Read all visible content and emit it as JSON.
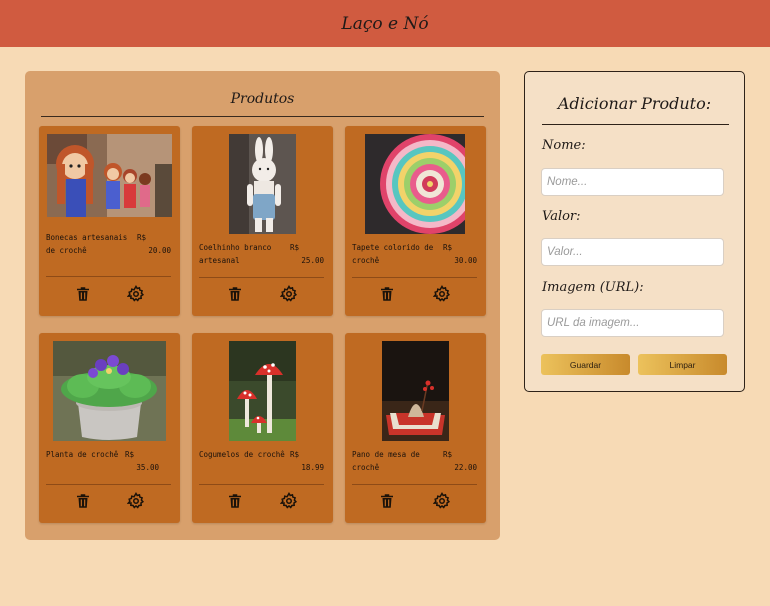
{
  "header": {
    "title": "Laço e Nó"
  },
  "products": {
    "title": "Produtos",
    "items": [
      {
        "name": "Bonecas artesanais de crochê",
        "currency": "R$",
        "price": "20.00",
        "image": "crochet-dolls"
      },
      {
        "name": "Coelhinho branco artesanal",
        "currency": "R$",
        "price": "25.00",
        "image": "crochet-bunny"
      },
      {
        "name": "Tapete colorido de crochê",
        "currency": "R$",
        "price": "30.00",
        "image": "crochet-mandala-rug"
      },
      {
        "name": "Planta de crochê",
        "currency": "R$",
        "price": "35.00",
        "image": "crochet-violet-plant"
      },
      {
        "name": "Cogumelos de crochê",
        "currency": "R$",
        "price": "18.99",
        "image": "crochet-mushrooms"
      },
      {
        "name": "Pano de mesa de crochê",
        "currency": "R$",
        "price": "22.00",
        "image": "crochet-tablecloth"
      }
    ],
    "icons": {
      "delete": "trash-icon",
      "edit": "gear-icon"
    }
  },
  "form": {
    "title": "Adicionar Produto:",
    "name_label": "Nome:",
    "name_placeholder": "Nome...",
    "value_label": "Valor:",
    "value_placeholder": "Valor...",
    "image_label": "Imagem (URL):",
    "image_placeholder": "URL da imagem...",
    "save_label": "Guardar",
    "clear_label": "Limpar"
  },
  "colors": {
    "header": "#d05b40",
    "background": "#f7dab5",
    "panel": "#d8a06c",
    "card": "#bf6a22",
    "form_panel": "#f5e0c6",
    "button_gradient_start": "#ecc25c",
    "button_gradient_end": "#c88a2c"
  }
}
